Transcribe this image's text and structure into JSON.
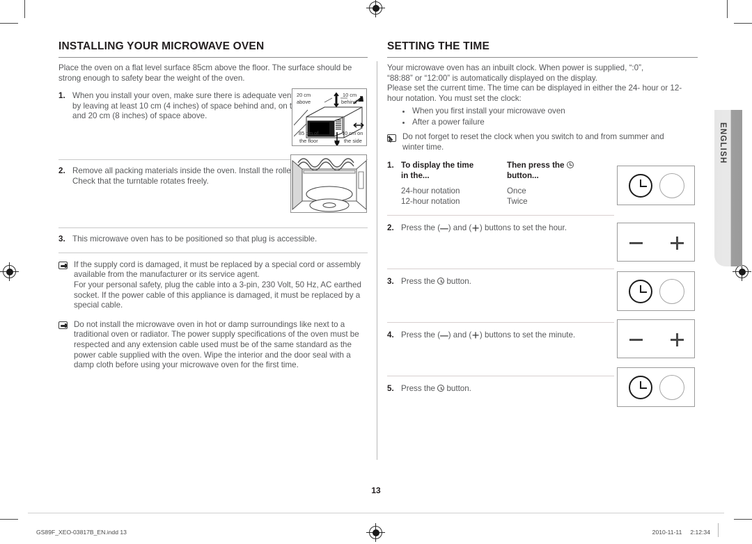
{
  "document": {
    "page_number": "13",
    "side_tab": "ENGLISH",
    "footer_file": "GS89F_XEO-03817B_EN.indd   13",
    "footer_date": "2010-11-11",
    "footer_time": "2:12:34"
  },
  "left_column": {
    "heading": "INSTALLING YOUR MICROWAVE OVEN",
    "intro": "Place the oven on a flat level surface 85cm above the floor. The surface should be strong enough to safety bear the weight of the oven.",
    "steps": [
      {
        "num": "1.",
        "text": "When you install your oven, make sure there is adequate ventilation for your oven by leaving at least 10 cm (4 inches) of space behind and, on the sides of the oven and 20 cm (8 inches) of space above.",
        "figure": "oven-clearance-diagram"
      },
      {
        "num": "2.",
        "text": "Remove all packing materials inside the oven. Install the roller ring and turntable. Check that the turntable rotates freely.",
        "figure": "oven-interior-diagram"
      },
      {
        "num": "3.",
        "text": "This microwave oven has to be positioned so that plug is accessible.",
        "figure": ""
      }
    ],
    "notes": [
      {
        "icon": "pointing-hand-icon",
        "text": "If the supply cord is damaged, it must be replaced by a special cord or assembly available from the manufacturer or its service agent.\nFor your personal safety, plug the cable into a 3-pin, 230 Volt, 50 Hz, AC earthed socket. If the power cable of this appliance is damaged, it must be replaced by a special cable."
      },
      {
        "icon": "pointing-hand-icon",
        "text": "Do not install the microwave oven in hot or damp surroundings like next to a traditional oven or radiator. The power supply specifications of the oven must be respected and any extension cable used must be of the same standard as the power cable supplied with the oven. Wipe the interior and the door seal with a damp cloth before using your microwave oven for the first time."
      }
    ],
    "figure_labels": {
      "above": "20 cm\nabove",
      "behind": "10 cm\nbehind",
      "floor": "85 cm of\nthe floor",
      "side": "10 cm on\nthe side",
      "l1": "20 cm",
      "l2": "above",
      "l3": "10 cm",
      "l4": "behind",
      "l5": "85 cm of",
      "l6": "the floor",
      "l7": "10 cm on",
      "l8": "the side"
    }
  },
  "right_column": {
    "heading": "SETTING THE TIME",
    "intro_line1": "Your microwave oven has an inbuilt clock. When power is supplied, “:0”,",
    "intro_line2": "“88:88” or “12:00” is automatically displayed on the display.",
    "intro_line3": "Please set the current time. The time can be displayed in either the 24- hour or 12-hour notation. You must set the clock:",
    "bullets": [
      "When you first install your microwave oven",
      "After a power failure"
    ],
    "note": {
      "icon": "pencil-note-icon",
      "text": "Do not forget to reset the clock when you switch to and from summer and winter time."
    },
    "table": {
      "num": "1.",
      "header_col1_line1": "To display the time",
      "header_col1_line2": "in the...",
      "header_col2_line1_pre": "Then press the",
      "header_col2_line1_icon": "clock-icon",
      "header_col2_line2": "button...",
      "rows": [
        {
          "col1": "24-hour notation",
          "col2": "Once"
        },
        {
          "col1": "12-hour notation",
          "col2": "Twice"
        }
      ],
      "figure": "control-panel-clock-knob"
    },
    "steps": [
      {
        "num": "2.",
        "text_pre": "Press the",
        "icon_a": "minus-icon",
        "text_mid": "and",
        "icon_b": "plus-icon",
        "text_post": "buttons to set the hour.",
        "figure": "control-panel-minus-plus"
      },
      {
        "num": "3.",
        "text_pre": "Press the",
        "icon_a": "clock-icon",
        "text_mid": "",
        "icon_b": "",
        "text_post": "button.",
        "figure": "control-panel-clock-knob"
      },
      {
        "num": "4.",
        "text_pre": "Press the",
        "icon_a": "minus-icon",
        "text_mid": "and",
        "icon_b": "plus-icon",
        "text_post": "buttons to set the minute.",
        "figure": "control-panel-minus-plus"
      },
      {
        "num": "5.",
        "text_pre": "Press the",
        "icon_a": "clock-icon",
        "text_mid": "",
        "icon_b": "",
        "text_post": "button.",
        "figure": "control-panel-clock-knob"
      }
    ],
    "glyphs": {
      "minus": "—",
      "plus": "＋",
      "paren_open": "(",
      "paren_close": ")"
    }
  },
  "colors": {
    "heading": "#231f20",
    "body": "#58595b",
    "rule": "#c9c9c9",
    "tab_grey": "#9e9e9e"
  }
}
